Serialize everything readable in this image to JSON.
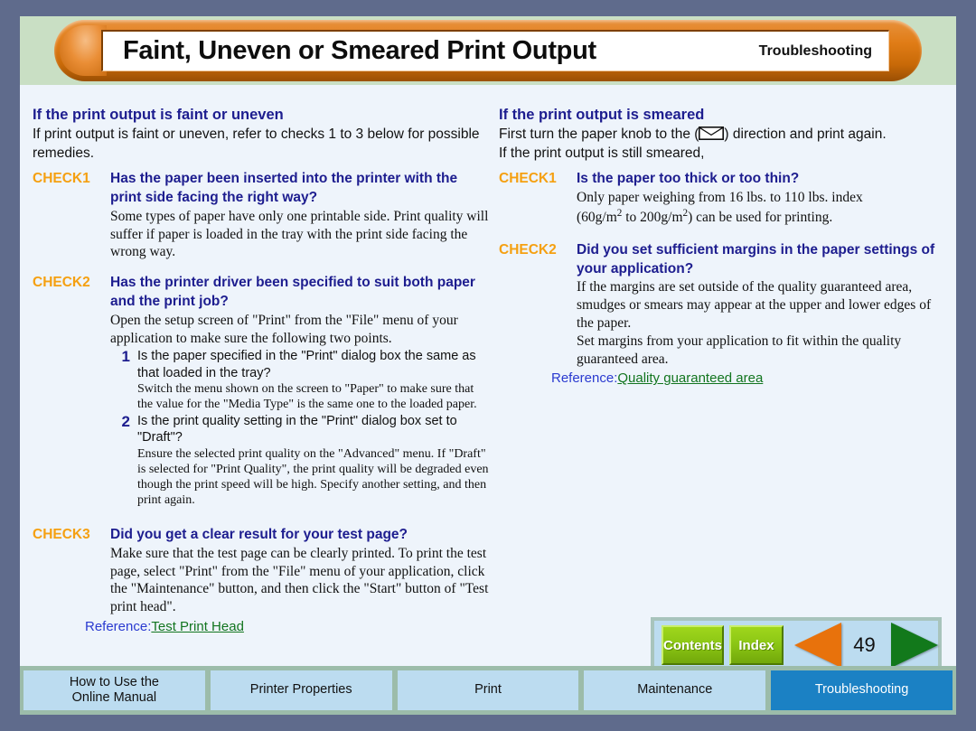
{
  "header": {
    "title": "Faint, Uneven or Smeared Print Output",
    "section": "Troubleshooting"
  },
  "left_column": {
    "heading": "If the print output is faint or uneven",
    "intro": "If print output is faint or uneven, refer to checks 1 to 3 below for possible remedies.",
    "checks": [
      {
        "tag": "CHECK1",
        "question": "Has the paper been inserted into the printer with the print side facing the right way?",
        "body": "Some types of paper have only one printable side. Print quality will suffer if paper is loaded in the tray with the print side facing the wrong way."
      },
      {
        "tag": "CHECK2",
        "question": "Has the printer driver been specified to suit both paper and the print job?",
        "body": "Open the setup screen of \"Print\" from the \"File\" menu of your application to make sure the following two points.",
        "items": [
          {
            "num": "1",
            "question": "Is the paper specified in the \"Print\" dialog box the same as that loaded in the tray?",
            "body": "Switch the menu shown on the screen to \"Paper\" to make sure that the value for the \"Media Type\" is the same one to the loaded paper."
          },
          {
            "num": "2",
            "question": "Is the print quality setting in the \"Print\" dialog box set to \"Draft\"?",
            "body": "Ensure the selected print quality on the \"Advanced\" menu. If \"Draft\" is selected for \"Print Quality\", the print quality will be degraded even though the print speed will be high. Specify another setting, and then print again."
          }
        ]
      },
      {
        "tag": "CHECK3",
        "question": "Did you get a clear result for your test page?",
        "body": "Make sure that the test page can be clearly printed. To print the test page, select \"Print\" from the \"File\" menu of your application, click the \"Maintenance\" button, and then click the \"Start\" button of \"Test print head\"."
      }
    ],
    "reference": {
      "label": "Reference:",
      "link": "Test Print Head"
    }
  },
  "right_column": {
    "heading": "If the print output is smeared",
    "intro_before_icon": "First turn the paper knob to the (",
    "intro_after_icon": ") direction and print again.",
    "intro_line2": "If the print output is still smeared,",
    "icon": "envelope-icon",
    "checks": [
      {
        "tag": "CHECK1",
        "question": "Is the paper too thick or too thin?",
        "body_line1": "Only paper weighing from 16 lbs. to 110 lbs. index",
        "body_line2_a": "(60g/m",
        "body_line2_sup1": "2",
        "body_line2_b": " to 200g/m",
        "body_line2_sup2": "2",
        "body_line2_c": ") can be used for printing."
      },
      {
        "tag": "CHECK2",
        "question": "Did you set sufficient margins in the paper settings of your application?",
        "body1": "If the margins are set outside of the quality guaranteed area, smudges or smears may appear at the upper and lower edges of the paper.",
        "body2": "Set margins from your application to fit within the quality guaranteed area."
      }
    ],
    "reference": {
      "label": "Reference:",
      "link": "Quality guaranteed area"
    }
  },
  "nav": {
    "contents_label": "Contents",
    "index_label": "Index",
    "prev_icon": "previous-page-arrow-icon",
    "next_icon": "next-page-arrow-icon",
    "page_number": "49"
  },
  "tabs": [
    {
      "label": "How to Use the\nOnline Manual",
      "active": false
    },
    {
      "label": "Printer Properties",
      "active": false
    },
    {
      "label": "Print",
      "active": false
    },
    {
      "label": "Maintenance",
      "active": false
    },
    {
      "label": "Troubleshooting",
      "active": true
    }
  ],
  "colors": {
    "outer_border": "#5f6b8c",
    "header_band": "#c9dfc4",
    "content_bg": "#eef4fb",
    "capsule_orange": "#e07c16",
    "check_tag": "#f5a011",
    "heading_navy": "#1d1d8f",
    "ref_label": "#2a3ad0",
    "ref_link": "#12751f",
    "tabbar_bg": "#9cbcaa",
    "tab_bg": "#bcdcf0",
    "tab_active": "#1b81c4",
    "green_button": "#8cc715",
    "prev_arrow": "#e8720c",
    "next_arrow": "#12791b"
  }
}
